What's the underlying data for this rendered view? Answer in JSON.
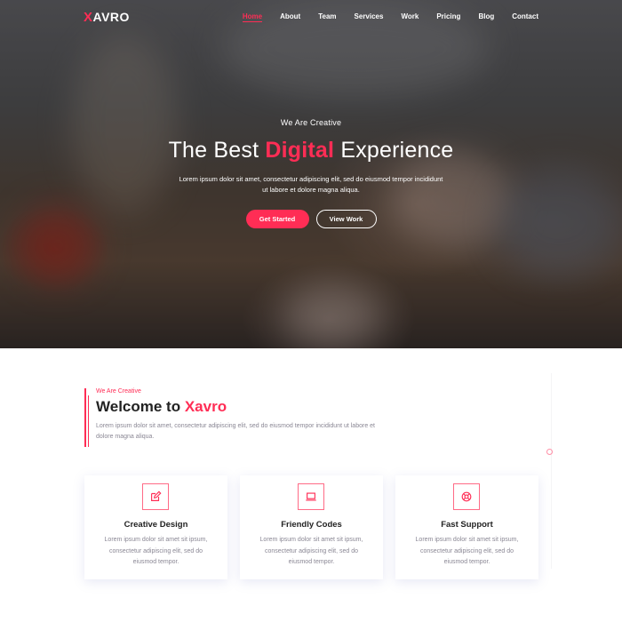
{
  "nav": {
    "logo_x": "X",
    "logo_rest": "AVRO",
    "items": [
      "Home",
      "About",
      "Team",
      "Services",
      "Work",
      "Pricing",
      "Blog",
      "Contact"
    ],
    "active": "Home"
  },
  "hero": {
    "eyebrow": "We Are Creative",
    "headline_before": "The Best ",
    "headline_highlight": "Digital",
    "headline_after": " Experience",
    "subtitle": "Lorem ipsum dolor sit amet, consectetur adipiscing elit, sed do eiusmod tempor incididunt ut labore et dolore magna aliqua.",
    "primary_button": "Get Started",
    "secondary_button": "View Work"
  },
  "welcome": {
    "eyebrow": "We Are Creative",
    "title_before": "Welcome to ",
    "title_highlight": "Xavro",
    "subtitle": "Lorem ipsum dolor sit amet, consectetur adipiscing elit, sed do eiusmod tempor incididunt ut labore et dolore magna aliqua."
  },
  "features": [
    {
      "icon": "edit-icon",
      "title": "Creative Design",
      "text": "Lorem ipsum dolor sit amet sit ipsum, consectetur adipiscing elit, sed do eiusmod tempor."
    },
    {
      "icon": "laptop-icon",
      "title": "Friendly Codes",
      "text": "Lorem ipsum dolor sit amet sit ipsum, consectetur adipiscing elit, sed do eiusmod tempor."
    },
    {
      "icon": "support-icon",
      "title": "Fast Support",
      "text": "Lorem ipsum dolor sit amet sit ipsum, consectetur adipiscing elit, sed do eiusmod tempor."
    }
  ],
  "colors": {
    "accent": "#ff2d55",
    "muted_text": "#8a8794",
    "heading_text": "#222222"
  }
}
